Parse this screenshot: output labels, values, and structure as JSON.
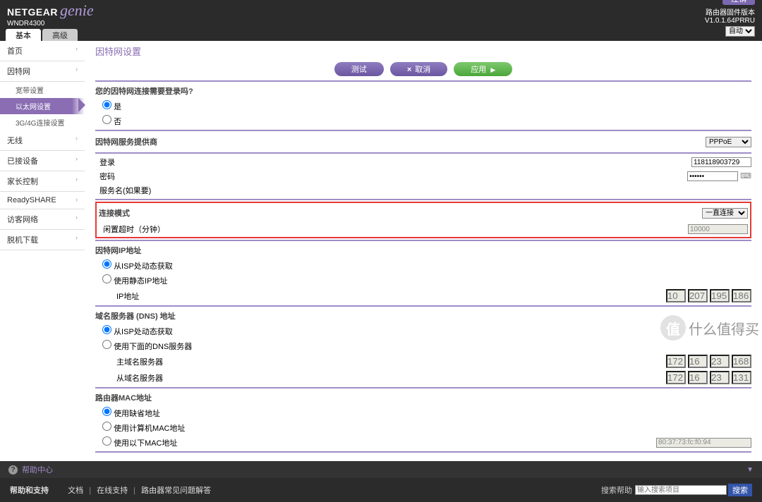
{
  "header": {
    "brand1": "NETGEAR",
    "brand2": "genie",
    "model": "WNDR4300",
    "logout": "注销",
    "fw_label": "路由器固件版本",
    "fw_ver": "V1.0.1.64PRRU",
    "auto_label": "自动"
  },
  "tabs": {
    "basic": "基本",
    "advanced": "高级"
  },
  "sidebar": {
    "home": "首页",
    "internet": "因特网",
    "sub_wan": "宽带设置",
    "sub_eth": "以太网设置",
    "sub_3g4g": "3G/4G连接设置",
    "wireless": "无线",
    "attached": "已接设备",
    "parental": "家长控制",
    "readyshare": "ReadySHARE",
    "guest": "访客网络",
    "offline": "脱机下载"
  },
  "page": {
    "title": "因特网设置",
    "btn_test": "测试",
    "btn_cancel": "取消",
    "btn_apply": "应用"
  },
  "q_login": {
    "title": "您的因特网连接需要登录吗?",
    "opt_yes": "是",
    "opt_no": "否"
  },
  "isp": {
    "title": "因特网服务提供商",
    "value": "PPPoE"
  },
  "login": {
    "user_l": "登录",
    "user_v": "118118903729",
    "pass_l": "密码",
    "pass_v": "••••••",
    "svc_l": "服务名(如果要)"
  },
  "conn": {
    "mode_l": "连接模式",
    "mode_v": "一直连接",
    "idle_l": "闲置超时（分钟）",
    "idle_v": "10000"
  },
  "ip": {
    "title": "因特网IP地址",
    "dyn": "从ISP处动态获取",
    "stat": "使用静态IP地址",
    "ipaddr_l": "IP地址",
    "oct": [
      "10",
      "207",
      "195",
      "186"
    ]
  },
  "dns": {
    "title": "域名服务器 (DNS) 地址",
    "dyn": "从ISP处动态获取",
    "stat": "使用下面的DNS服务器",
    "prim_l": "主域名服务器",
    "sec_l": "从域名服务器",
    "prim": [
      "172",
      "16",
      "23",
      "168"
    ],
    "sec": [
      "172",
      "16",
      "23",
      "131"
    ]
  },
  "mac": {
    "title": "路由器MAC地址",
    "def": "使用缺省地址",
    "pc": "使用计算机MAC地址",
    "this": "使用以下MAC地址",
    "val": "80:37:73:fc:f0:94"
  },
  "help": {
    "label": "帮助中心",
    "support": "帮助和支持",
    "doc": "文档",
    "online": "在线支持",
    "faq": "路由器常见问题解答",
    "search_ph": "输入搜索项目",
    "search_btn": "搜索"
  },
  "wm": {
    "icon": "值",
    "text": "什么值得买"
  }
}
